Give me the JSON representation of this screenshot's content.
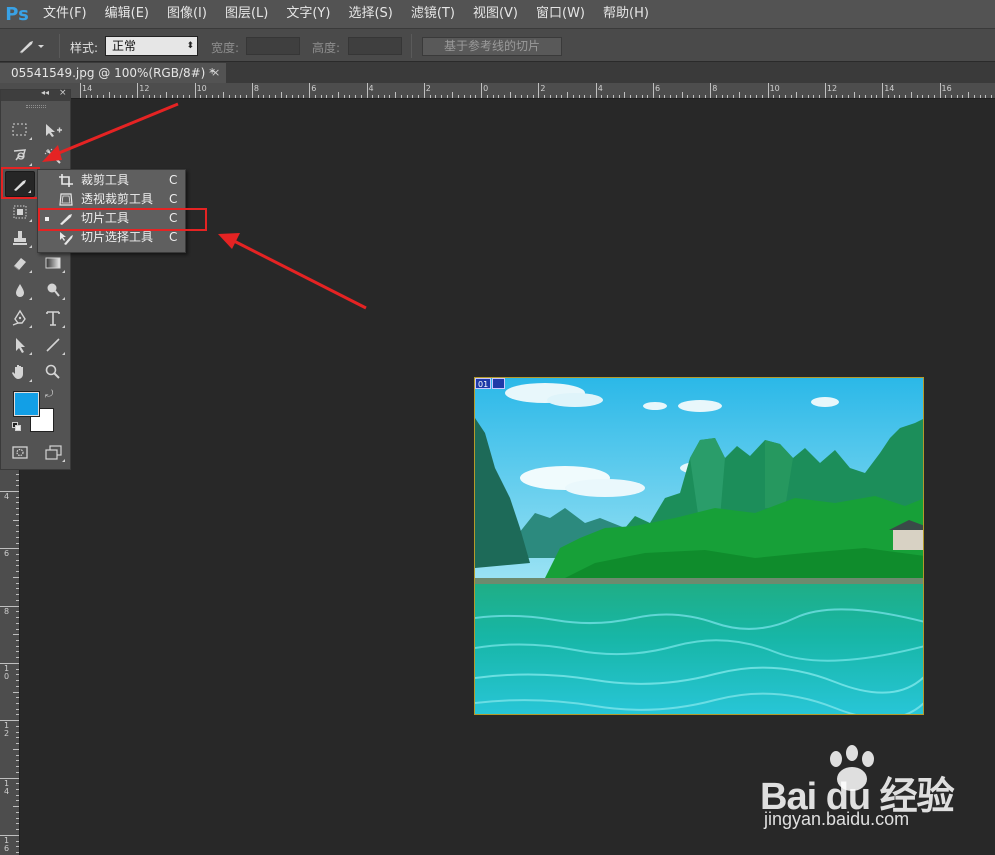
{
  "app": {
    "logo": "Ps"
  },
  "menubar": {
    "items": [
      "文件(F)",
      "编辑(E)",
      "图像(I)",
      "图层(L)",
      "文字(Y)",
      "选择(S)",
      "滤镜(T)",
      "视图(V)",
      "窗口(W)",
      "帮助(H)"
    ]
  },
  "options": {
    "style_label": "样式:",
    "style_value": "正常",
    "width_label": "宽度:",
    "height_label": "高度:",
    "guides_button": "基于参考线的切片"
  },
  "document": {
    "tab_title": "05541549.jpg @ 100%(RGB/8#) *",
    "close_symbol": "×"
  },
  "ruler": {
    "top_labels": [
      "14",
      "12",
      "10",
      "8",
      "6",
      "4",
      "2",
      "0",
      "2",
      "4",
      "6",
      "8",
      "10",
      "12",
      "14",
      "16"
    ],
    "left_labels": [
      "4",
      "6",
      "8",
      "1\n0",
      "1\n2",
      "1\n4",
      "1\n6"
    ]
  },
  "toolbox": {
    "collapse_symbol": "◂◂",
    "close_symbol": "×"
  },
  "flyout": {
    "items": [
      {
        "label": "裁剪工具",
        "key": "C",
        "icon": "crop-icon",
        "selected": false
      },
      {
        "label": "透视裁剪工具",
        "key": "C",
        "icon": "perspective-crop-icon",
        "selected": false
      },
      {
        "label": "切片工具",
        "key": "C",
        "icon": "slice-icon",
        "selected": true
      },
      {
        "label": "切片选择工具",
        "key": "C",
        "icon": "slice-select-icon",
        "selected": false
      }
    ]
  },
  "slice": {
    "number": "01"
  },
  "colors": {
    "foreground": "#129fe6",
    "background": "#ffffff",
    "annotation": "#e52323"
  },
  "watermark": {
    "brand": "Bai du 经验",
    "url": "jingyan.baidu.com"
  }
}
